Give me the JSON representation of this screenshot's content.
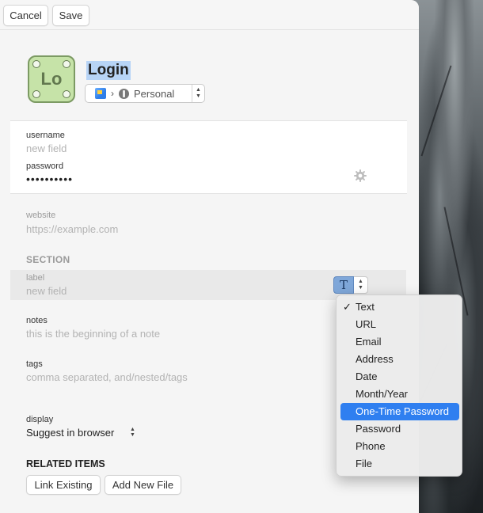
{
  "toolbar": {
    "cancel_label": "Cancel",
    "save_label": "Save"
  },
  "item": {
    "icon_text": "Lo",
    "title": "Login",
    "vault": {
      "name": "Personal"
    }
  },
  "login_fields": {
    "username": {
      "label": "username",
      "placeholder": "new field"
    },
    "password": {
      "label": "password",
      "value": "••••••••••"
    }
  },
  "website": {
    "label": "website",
    "placeholder": "https://example.com"
  },
  "section": {
    "heading": "SECTION",
    "field": {
      "label": "label",
      "placeholder": "new field"
    }
  },
  "notes": {
    "label": "notes",
    "placeholder": "this is the beginning of a note"
  },
  "tags": {
    "label": "tags",
    "placeholder": "comma separated, and/nested/tags"
  },
  "display": {
    "label": "display",
    "value": "Suggest in browser"
  },
  "related": {
    "heading": "RELATED ITEMS",
    "link_existing": "Link Existing",
    "add_new_file": "Add New File"
  },
  "type_menu": {
    "checked_item": "Text",
    "highlighted_item": "One-Time Password",
    "items": [
      "Text",
      "URL",
      "Email",
      "Address",
      "Date",
      "Month/Year",
      "One-Time Password",
      "Password",
      "Phone",
      "File"
    ]
  },
  "colors": {
    "accent": "#2f7ff0",
    "logo_fill": "#c6e3a8",
    "title_highlight": "#b7d4f6"
  },
  "icons": [
    "flag-icon",
    "vault-icon",
    "gear-icon",
    "text-type-icon",
    "checkmark-icon",
    "up-down-chevron-icon"
  ]
}
